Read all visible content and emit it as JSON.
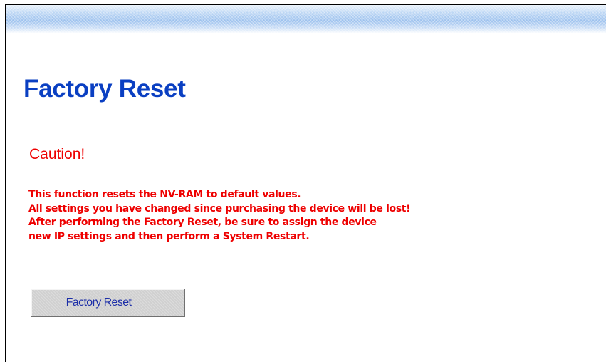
{
  "page": {
    "title": "Factory Reset",
    "caution": "Caution!",
    "warning_lines": [
      "This function resets the NV-RAM to default values.",
      "All settings you have changed since purchasing the device will be lost!",
      "After performing the Factory Reset, be sure to assign the device",
      "new IP settings and then perform a System Restart."
    ],
    "button_label": "Factory Reset"
  },
  "colors": {
    "title": "#0a3fc2",
    "warning": "#ee0000",
    "button_text": "#1c2ea8",
    "button_face": "#d0d0d0"
  }
}
